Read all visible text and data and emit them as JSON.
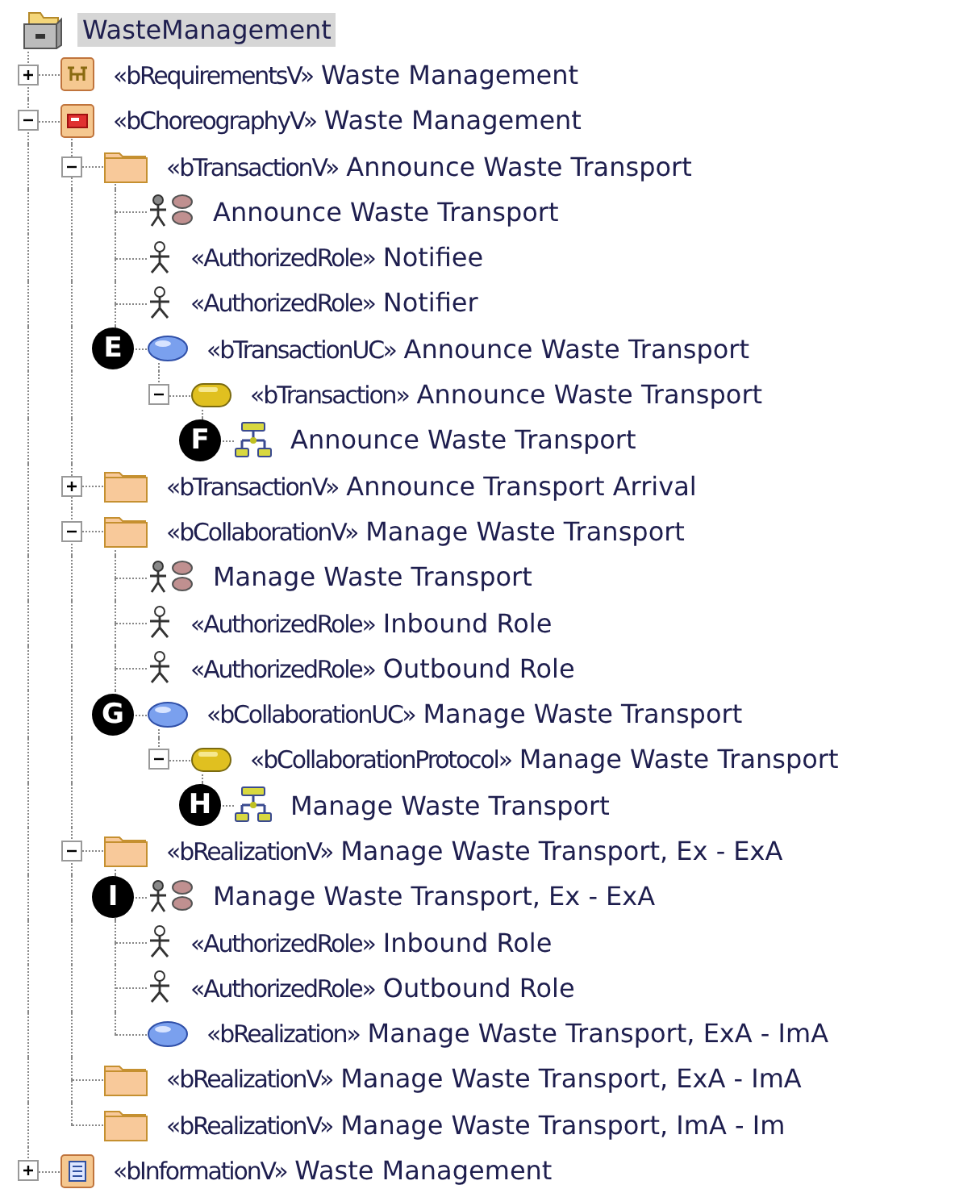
{
  "tree": [
    {
      "kind": "model",
      "name": "WasteManagement",
      "selected": true,
      "children": [
        {
          "kind": "requirements",
          "stereotype": "«bRequirementsV»",
          "name": "Waste Management",
          "expanded": false,
          "selected": false
        },
        {
          "kind": "choreography",
          "stereotype": "«bChoreographyV»",
          "name": "Waste Management",
          "expanded": true,
          "selected": false,
          "children": [
            {
              "kind": "folder",
              "stereotype": "«bTransactionV»",
              "name": "Announce Waste Transport",
              "expanded": true,
              "selected": false,
              "children": [
                {
                  "kind": "collaboration",
                  "name": "Announce Waste Transport",
                  "selected": false
                },
                {
                  "kind": "role",
                  "stereotype": "«AuthorizedRole»",
                  "name": "Notifiee",
                  "selected": false
                },
                {
                  "kind": "role",
                  "stereotype": "«AuthorizedRole»",
                  "name": "Notifier",
                  "selected": false
                },
                {
                  "kind": "usecase",
                  "stereotype": "«bTransactionUC»",
                  "name": "Announce Waste Transport",
                  "badge": "E",
                  "selected": false,
                  "children": [
                    {
                      "kind": "transaction",
                      "stereotype": "«bTransaction»",
                      "name": "Announce Waste Transport",
                      "expanded": true,
                      "selected": false,
                      "children": [
                        {
                          "kind": "activity",
                          "name": "Announce Waste Transport",
                          "badge": "F",
                          "selected": false
                        }
                      ]
                    }
                  ]
                }
              ]
            },
            {
              "kind": "folder",
              "stereotype": "«bTransactionV»",
              "name": "Announce Transport Arrival",
              "expanded": false,
              "selected": false
            },
            {
              "kind": "folder",
              "stereotype": "«bCollaborationV»",
              "name": "Manage Waste Transport",
              "expanded": true,
              "selected": false,
              "children": [
                {
                  "kind": "collaboration",
                  "name": "Manage Waste Transport",
                  "selected": false
                },
                {
                  "kind": "role",
                  "stereotype": "«AuthorizedRole»",
                  "name": "Inbound Role",
                  "selected": false
                },
                {
                  "kind": "role",
                  "stereotype": "«AuthorizedRole»",
                  "name": "Outbound Role",
                  "selected": false
                },
                {
                  "kind": "usecase",
                  "stereotype": "«bCollaborationUC»",
                  "name": "Manage Waste Transport",
                  "badge": "G",
                  "selected": false,
                  "children": [
                    {
                      "kind": "transaction",
                      "stereotype": "«bCollaborationProtocol»",
                      "name": "Manage Waste Transport",
                      "expanded": true,
                      "selected": false,
                      "children": [
                        {
                          "kind": "activity",
                          "name": "Manage Waste Transport",
                          "badge": "H",
                          "selected": false
                        }
                      ]
                    }
                  ]
                }
              ]
            },
            {
              "kind": "folder",
              "stereotype": "«bRealizationV»",
              "name": "Manage Waste Transport, Ex - ExA",
              "expanded": true,
              "selected": false,
              "children": [
                {
                  "kind": "collaboration",
                  "name": "Manage Waste Transport, Ex - ExA",
                  "badge": "I",
                  "selected": false
                },
                {
                  "kind": "role",
                  "stereotype": "«AuthorizedRole»",
                  "name": "Inbound Role",
                  "selected": false
                },
                {
                  "kind": "role",
                  "stereotype": "«AuthorizedRole»",
                  "name": "Outbound Role",
                  "selected": false
                },
                {
                  "kind": "usecase",
                  "stereotype": "«bRealization»",
                  "name": "Manage Waste Transport, ExA - ImA",
                  "selected": false
                }
              ]
            },
            {
              "kind": "folder",
              "stereotype": "«bRealizationV»",
              "name": "Manage Waste Transport, ExA - ImA",
              "selected": false
            },
            {
              "kind": "folder",
              "stereotype": "«bRealizationV»",
              "name": "Manage Waste Transport, ImA - Im",
              "selected": false
            }
          ]
        },
        {
          "kind": "information",
          "stereotype": "«bInformationV»",
          "name": "Waste Management",
          "expanded": false,
          "selected": false
        }
      ]
    }
  ]
}
